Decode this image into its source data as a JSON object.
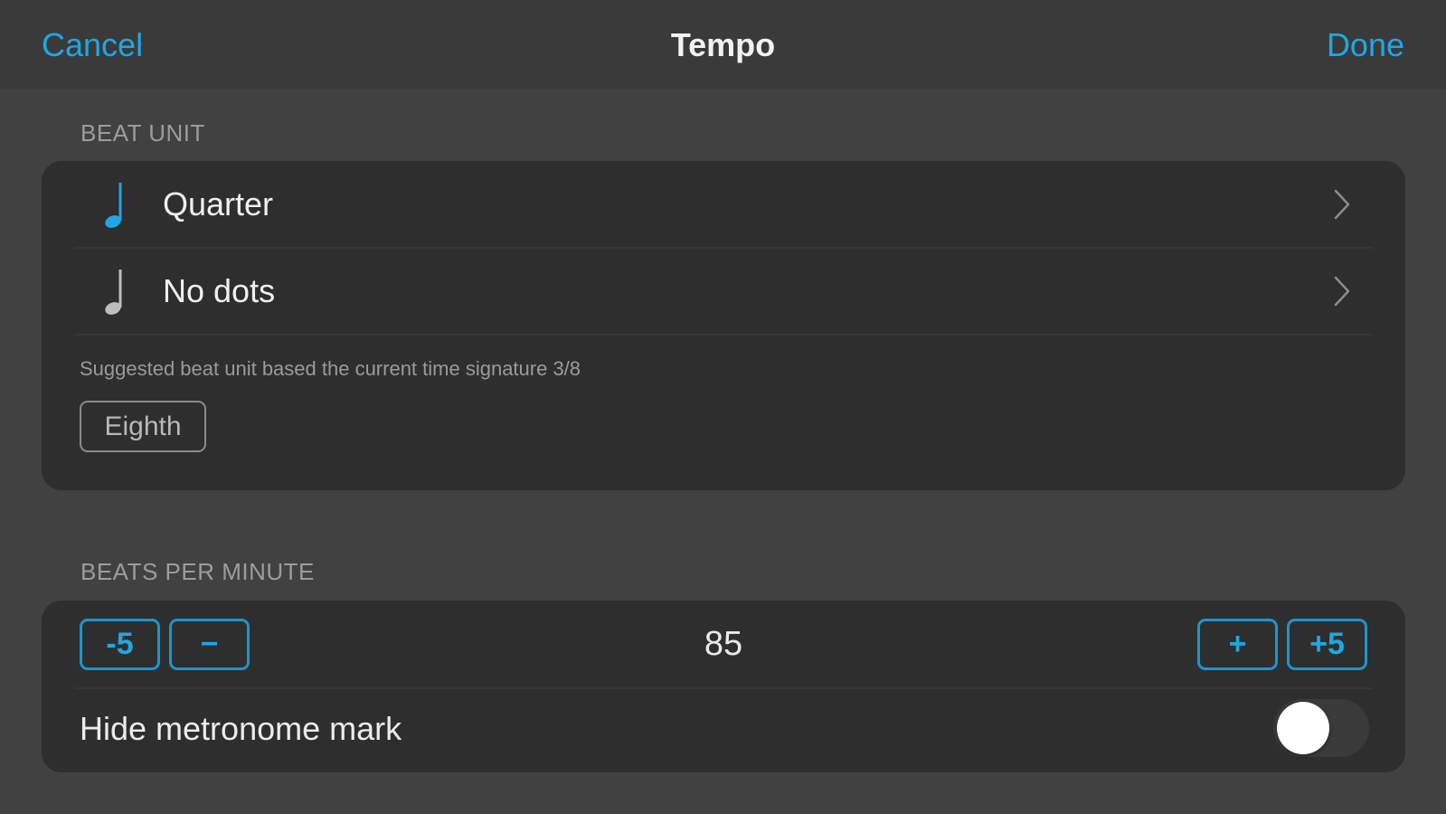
{
  "navbar": {
    "cancel_label": "Cancel",
    "title": "Tempo",
    "done_label": "Done"
  },
  "beat_unit": {
    "header": "BEAT UNIT",
    "rows": [
      {
        "label": "Quarter",
        "icon": "quarter-note-icon",
        "icon_color": "#1ea7e4"
      },
      {
        "label": "No dots",
        "icon": "quarter-note-icon",
        "icon_color": "#bdbdbd"
      }
    ],
    "hint": "Suggested beat unit based the current time signature 3/8",
    "suggestion_button": "Eighth"
  },
  "bpm": {
    "header": "BEATS PER MINUTE",
    "value": "85",
    "buttons": {
      "minus5": "-5",
      "minus": "−",
      "plus": "+",
      "plus5": "+5"
    },
    "hide_label": "Hide metronome mark",
    "hide_enabled": false
  },
  "colors": {
    "accent": "#1ea7e4",
    "background": "#414141",
    "card": "#2e2e2e"
  }
}
